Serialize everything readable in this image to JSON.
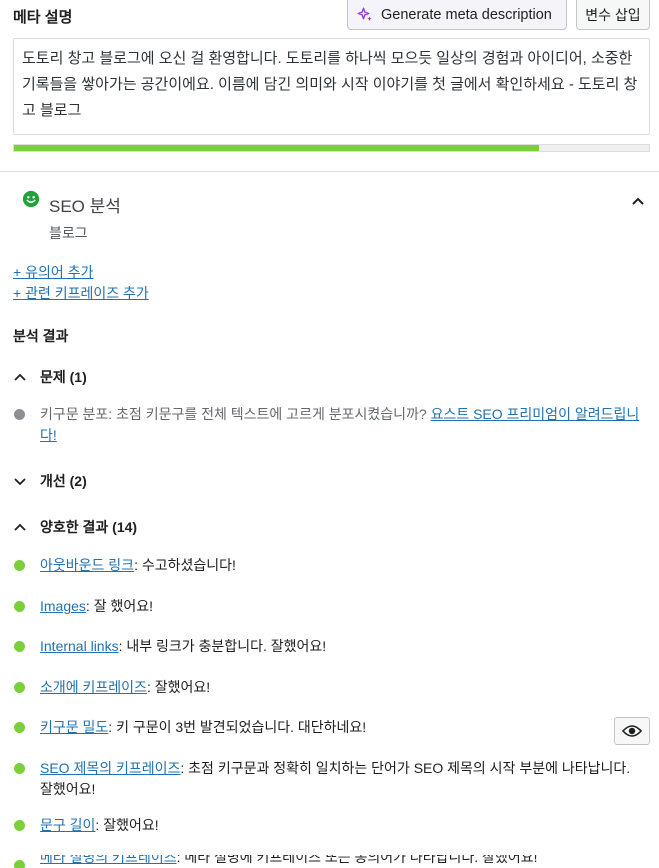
{
  "meta": {
    "label": "메타 설명",
    "generate_button": "Generate meta description",
    "insert_variable_button": "변수 삽입",
    "description": "도토리 창고 블로그에 오신 걸 환영합니다. 도토리를 하나씩 모으듯 일상의 경험과 아이디어, 소중한 기록들을 쌓아가는 공간이에요. 이름에 담긴 의미와 시작 이야기를 첫 글에서 확인하세요 - 도토리 창고 블로그",
    "progress_fraction": 0.826,
    "progress_color": "#7ad03a"
  },
  "seo": {
    "title": "SEO 분석",
    "keyphrase": "블로그",
    "add_synonyms": "+ 유의어 추가",
    "add_related": "+ 관련 키프레이즈 추가",
    "results_title": "분석 결과"
  },
  "groups": {
    "problems": {
      "label": "문제 (1)"
    },
    "improvements": {
      "label": "개선 (2)"
    },
    "good": {
      "label": "양호한 결과 (14)"
    }
  },
  "problem_items": [
    {
      "text": "키구문 분포: 초점 키문구를 전체 텍스트에 고르게 분포시켰습니까? ",
      "link": "요스트 SEO 프리미엄이 알려드립니다!",
      "color": "#8c8f94"
    }
  ],
  "good_items": [
    {
      "link": "아웃바운드 링크",
      "text": ": 수고하셨습니다!"
    },
    {
      "link": "Images",
      "text": ": 잘 했어요!"
    },
    {
      "link": "Internal links",
      "text": ": 내부 링크가 충분합니다. 잘했어요!"
    },
    {
      "link": "소개에 키프레이즈",
      "text": ": 잘했어요!"
    },
    {
      "link": "키구문 밀도",
      "text": ": 키 구문이 3번 발견되었습니다. 대단하네요!"
    },
    {
      "link": "SEO 제목의 키프레이즈",
      "text": ": 초점 키구문과 정확히 일치하는 단어가 SEO 제목의 시작 부분에 나타납니다. 잘했어요!"
    },
    {
      "link": "문구 길이",
      "text": ": 잘했어요!"
    },
    {
      "link": "메타 설명의 키프레이즈",
      "text": ": 메타 설명에 키프레이즈 또는 동의어가 나타납니다. 잘했어요!"
    }
  ],
  "colors": {
    "good": "#7ad03a",
    "link": "#2271b1",
    "smile": "#1fa33b"
  },
  "icons": {
    "sparkle": "sparkle-icon",
    "smile": "smiley-icon",
    "chevron_up": "chevron-up-icon",
    "chevron_down": "chevron-down-icon",
    "eye": "eye-icon"
  }
}
